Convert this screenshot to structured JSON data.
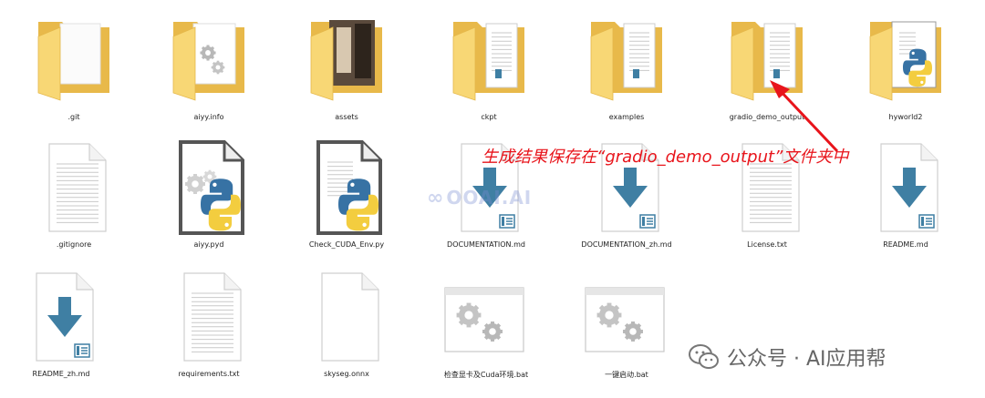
{
  "files": [
    {
      "name": ".git",
      "type": "folder",
      "overlay": "none"
    },
    {
      "name": "aiyy.info",
      "type": "folder",
      "overlay": "gears"
    },
    {
      "name": "assets",
      "type": "folder",
      "overlay": "photo"
    },
    {
      "name": "ckpt",
      "type": "folder",
      "overlay": "doc"
    },
    {
      "name": "examples",
      "type": "folder",
      "overlay": "doc"
    },
    {
      "name": "gradio_demo_output",
      "type": "folder",
      "overlay": "doc"
    },
    {
      "name": "hyworld2",
      "type": "folder",
      "overlay": "python"
    },
    {
      "name": ".gitignore",
      "type": "text"
    },
    {
      "name": "aiyy.pyd",
      "type": "pyd"
    },
    {
      "name": "Check_CUDA_Env.py",
      "type": "py"
    },
    {
      "name": "DOCUMENTATION.md",
      "type": "md"
    },
    {
      "name": "DOCUMENTATION_zh.md",
      "type": "md"
    },
    {
      "name": "License.txt",
      "type": "text"
    },
    {
      "name": "README.md",
      "type": "md"
    },
    {
      "name": "README_zh.md",
      "type": "md"
    },
    {
      "name": "requirements.txt",
      "type": "text"
    },
    {
      "name": "skyseg.onnx",
      "type": "blank"
    },
    {
      "name": "检查显卡及Cuda环境.bat",
      "type": "bat"
    },
    {
      "name": "一键启动.bat",
      "type": "bat"
    }
  ],
  "annotation": "生成结果保存在“gradio_demo_output”文件夹中",
  "watermark": "OOAI.AI",
  "footer": "公众号 · AI应用帮",
  "colors": {
    "folder_back": "#e8b94a",
    "folder_front": "#f8d775",
    "annotation": "#e8141b",
    "md_arrow": "#3f7fa3",
    "python_blue": "#3772a4",
    "python_yellow": "#f3cd3f"
  }
}
